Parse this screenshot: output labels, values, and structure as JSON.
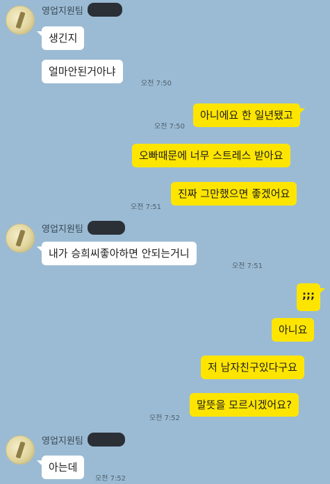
{
  "sender": {
    "name": "영업지원팀"
  },
  "messages": [
    {
      "text": "생긴지"
    },
    {
      "text": "얼마안된거아냐",
      "time": "오전 7:50"
    },
    {
      "text": "아니에요 한 일년됐고",
      "time": "오전 7:50"
    },
    {
      "text": "오빠때문에 너무 스트레스 받아요"
    },
    {
      "text": "진짜 그만했으면 좋겠어요",
      "time": "오전 7:51"
    },
    {
      "text": "내가 승희씨좋아하면 안되는거니",
      "time": "오전 7:51"
    },
    {
      "text": ";;;"
    },
    {
      "text": "아니요"
    },
    {
      "text": "저 남자친구있다구요"
    },
    {
      "text": "말뜻을 모르시겠어요?",
      "time": "오전 7:52"
    },
    {
      "text": "아는데",
      "time": "오전 7:52"
    }
  ]
}
